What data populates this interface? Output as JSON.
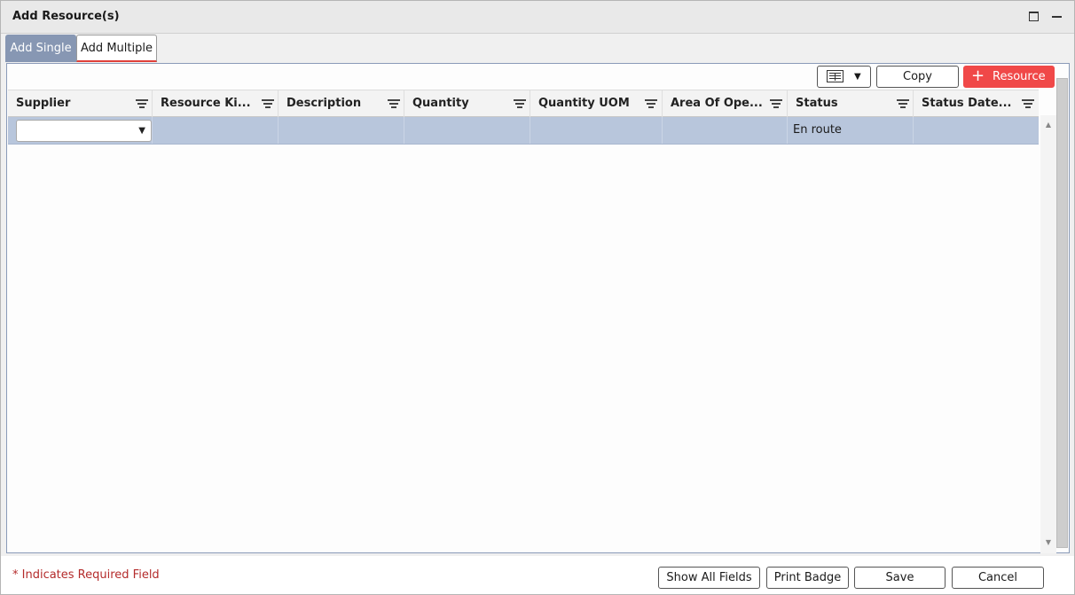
{
  "window": {
    "title": "Add Resource(s)"
  },
  "tabs": [
    {
      "label": "Add Single",
      "active": true
    },
    {
      "label": "Add Multiple",
      "active": false
    }
  ],
  "toolbar": {
    "copy_label": "Copy",
    "add_resource_label": "Resource"
  },
  "grid": {
    "columns": [
      "Supplier",
      "Resource Ki...",
      "Description",
      "Quantity",
      "Quantity UOM",
      "Area Of Ope...",
      "Status",
      "Status Date..."
    ],
    "rows": [
      {
        "supplier": "",
        "resource_kind": "",
        "description": "",
        "quantity": "",
        "quantity_uom": "",
        "area_of_operation": "",
        "status": "En route",
        "status_date": ""
      }
    ]
  },
  "footer": {
    "required_note": "* Indicates Required Field",
    "show_all_label": "Show All Fields",
    "print_badge_label": "Print Badge",
    "save_label": "Save",
    "cancel_label": "Cancel"
  },
  "colors": {
    "active_tab": "#8797b3",
    "add_button": "#f04848",
    "selected_row": "#b8c6dc",
    "required_text": "#b42b2b"
  }
}
